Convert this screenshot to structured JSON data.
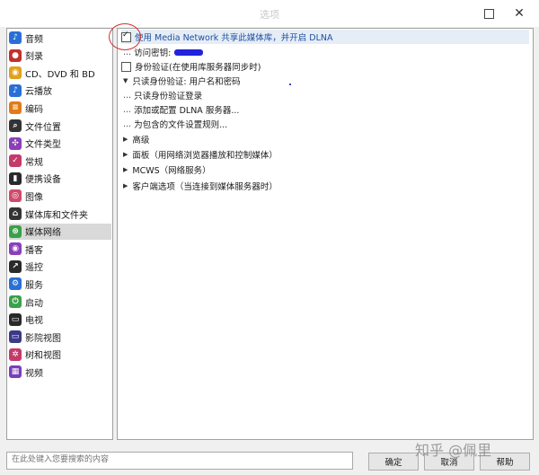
{
  "window": {
    "title": "选项",
    "minimize_icon": "minimize-icon",
    "close_label": "✕"
  },
  "sidebar": {
    "items": [
      {
        "label": "音频",
        "icon": "music-note-icon",
        "color": "#2a6fd6",
        "glyph": "♪"
      },
      {
        "label": "刻录",
        "icon": "burn-disc-icon",
        "color": "#c4302b",
        "glyph": "●"
      },
      {
        "label": "CD、DVD 和 BD",
        "icon": "cd-icon",
        "color": "#e0a020",
        "glyph": "◉"
      },
      {
        "label": "云播放",
        "icon": "cloud-music-icon",
        "color": "#2a6fd6",
        "glyph": "♪"
      },
      {
        "label": "编码",
        "icon": "encode-icon",
        "color": "#e07b1a",
        "glyph": "≡"
      },
      {
        "label": "文件位置",
        "icon": "file-search-icon",
        "color": "#333333",
        "glyph": "⌕"
      },
      {
        "label": "文件类型",
        "icon": "puzzle-icon",
        "color": "#8a3fb8",
        "glyph": "✣"
      },
      {
        "label": "常规",
        "icon": "checklist-icon",
        "color": "#c43a6b",
        "glyph": "✓"
      },
      {
        "label": "便携设备",
        "icon": "portable-device-icon",
        "color": "#2a2a2a",
        "glyph": "▮"
      },
      {
        "label": "图像",
        "icon": "camera-icon",
        "color": "#d04a6a",
        "glyph": "◎"
      },
      {
        "label": "媒体库和文件夹",
        "icon": "library-icon",
        "color": "#333333",
        "glyph": "⌂"
      },
      {
        "label": "媒体网络",
        "icon": "network-icon",
        "color": "#3aa04a",
        "glyph": "⊛"
      },
      {
        "label": "播客",
        "icon": "podcast-icon",
        "color": "#8a3fb8",
        "glyph": "◉"
      },
      {
        "label": "遥控",
        "icon": "remote-icon",
        "color": "#2a2a2a",
        "glyph": "↗"
      },
      {
        "label": "服务",
        "icon": "service-icon",
        "color": "#2a6fd6",
        "glyph": "⚙"
      },
      {
        "label": "启动",
        "icon": "power-icon",
        "color": "#3aa04a",
        "glyph": "⏻"
      },
      {
        "label": "电视",
        "icon": "tv-icon",
        "color": "#2a2a2a",
        "glyph": "▭"
      },
      {
        "label": "影院视图",
        "icon": "theater-icon",
        "color": "#3a3a8a",
        "glyph": "▭"
      },
      {
        "label": "树和视图",
        "icon": "tree-icon",
        "color": "#c43a6b",
        "glyph": "✲"
      },
      {
        "label": "视频",
        "icon": "film-icon",
        "color": "#7a3fb8",
        "glyph": "▦"
      }
    ],
    "selected_index": 11
  },
  "content": {
    "enable_dlna_label": "使用 Media Network 共享此媒体库，并开启 DLNA",
    "enable_dlna_checked": true,
    "access_key_label": "访问密钥:",
    "auth_label": "身份验证(在使用库服务器同步时)",
    "auth_checked": false,
    "readonly_userpass": "只读身份验证: 用户名和密码",
    "readonly_login": "只读身份验证登录",
    "add_dlna": "添加或配置 DLNA 服务器...",
    "include_files": "为包含的文件设置规则...",
    "advanced": "高级",
    "panel": "面板（用网络浏览器播放和控制媒体）",
    "mcws": "MCWS（网络服务）",
    "client_options": "客户端选项（当连接到媒体服务器时）"
  },
  "footer": {
    "search_placeholder": "在此处键入您要搜索的内容",
    "ok": "确定",
    "cancel": "取消",
    "help": "帮助"
  },
  "watermark": "知乎 @佩里"
}
